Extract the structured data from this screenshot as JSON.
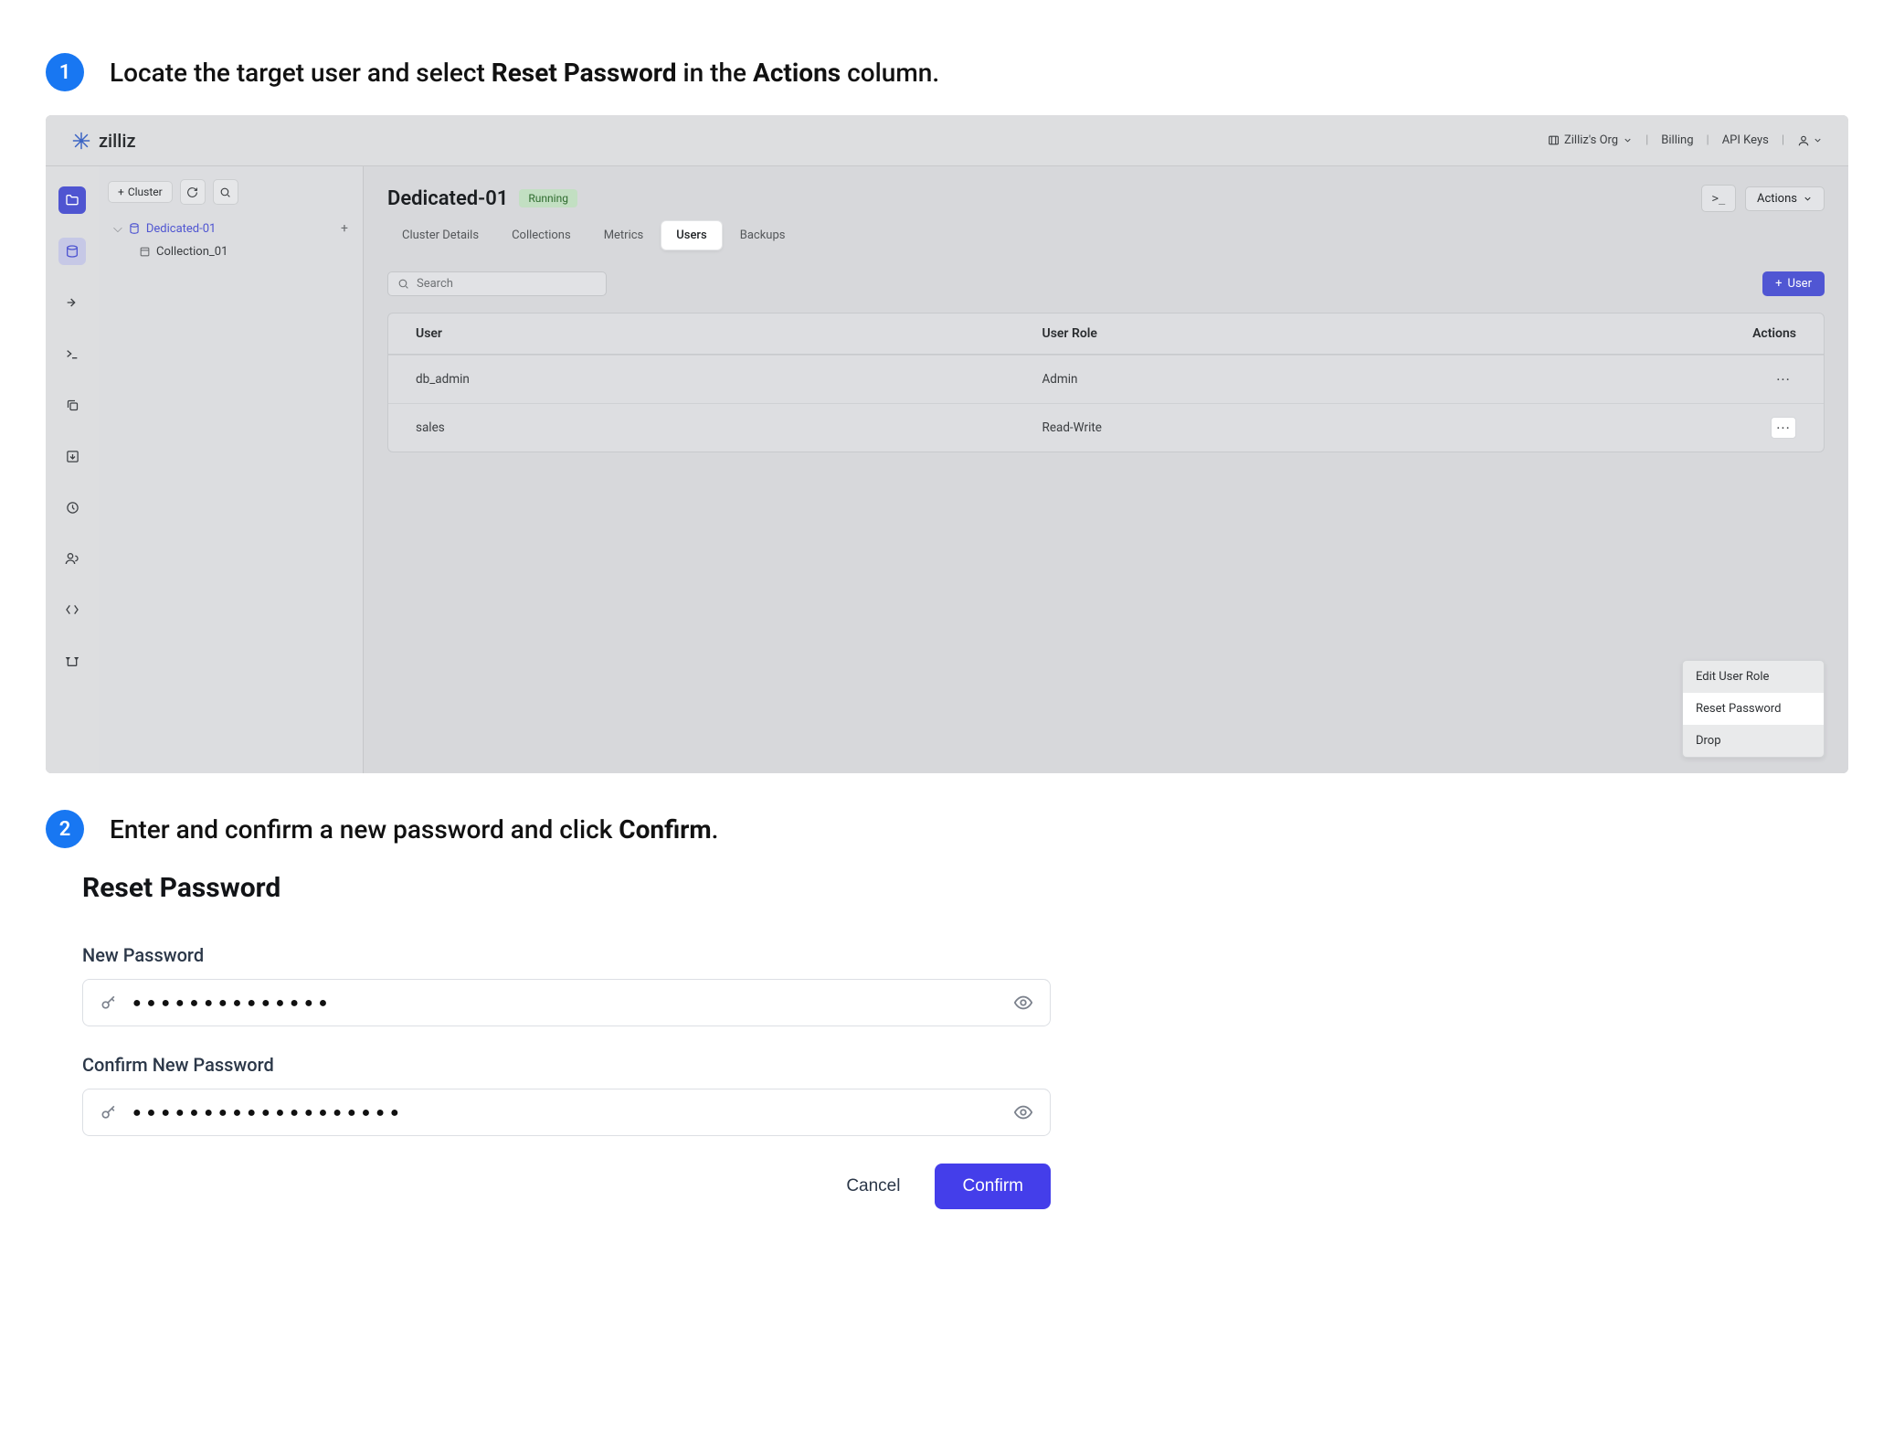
{
  "steps": {
    "s1_num": "1",
    "s1_pre": "Locate the target user and select ",
    "s1_b1": "Reset Password",
    "s1_mid": " in the ",
    "s1_b2": "Actions",
    "s1_post": " column.",
    "s2_num": "2",
    "s2_pre": "Enter and confirm a new password and click ",
    "s2_b1": "Confirm",
    "s2_post": "."
  },
  "topbar": {
    "brand": "zilliz",
    "org_label": "Zilliz's Org",
    "billing": "Billing",
    "api_keys": "API Keys"
  },
  "sidebar": {
    "cluster_btn": "Cluster",
    "cluster_name": "Dedicated-01",
    "collection_name": "Collection_01"
  },
  "page": {
    "title": "Dedicated-01",
    "status": "Running",
    "terminal": ">_",
    "actions_label": "Actions"
  },
  "tabs": {
    "details": "Cluster Details",
    "collections": "Collections",
    "metrics": "Metrics",
    "users": "Users",
    "backups": "Backups"
  },
  "toolbar": {
    "search_placeholder": "Search",
    "add_user": "User"
  },
  "table": {
    "col_user": "User",
    "col_role": "User Role",
    "col_actions": "Actions",
    "rows": [
      {
        "user": "db_admin",
        "role": "Admin"
      },
      {
        "user": "sales",
        "role": "Read-Write"
      }
    ]
  },
  "dropdown": {
    "edit": "Edit User Role",
    "reset": "Reset Password",
    "drop": "Drop"
  },
  "form": {
    "title": "Reset Password",
    "new_pw_label": "New Password",
    "confirm_pw_label": "Confirm New Password",
    "pw_mask_1": "●●●●●●●●●●●●●●",
    "pw_mask_2": "●●●●●●●●●●●●●●●●●●●",
    "cancel": "Cancel",
    "confirm": "Confirm"
  }
}
